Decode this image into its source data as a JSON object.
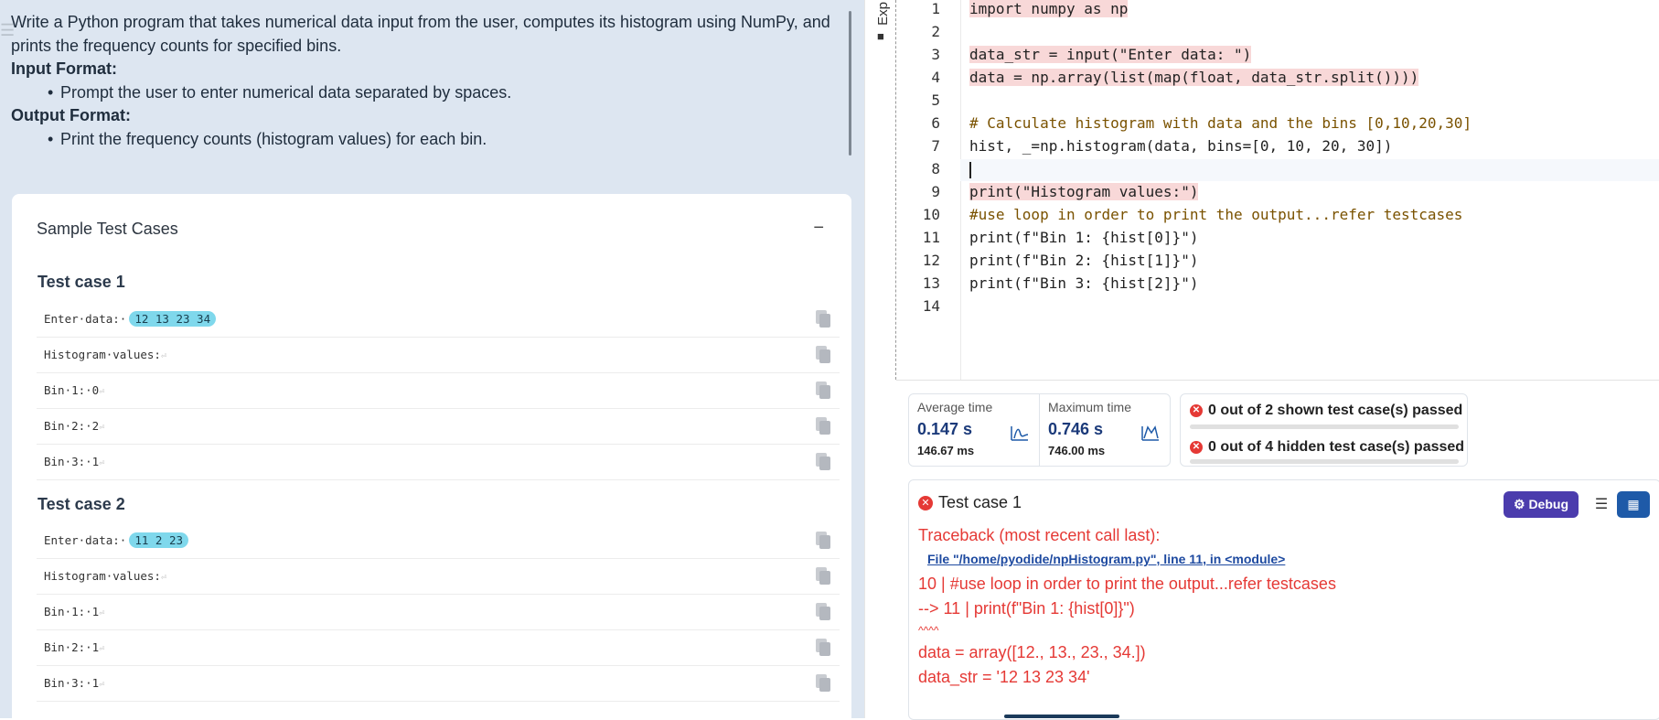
{
  "problem": {
    "line1": "Write a Python program that takes numerical data input from the user, computes its histogram using NumPy, and",
    "line2": "prints the frequency counts for specified bins.",
    "input_heading": "Input Format:",
    "input_bullet": "Prompt the user to enter numerical data separated by spaces.",
    "output_heading": "Output Format:",
    "output_bullet": "Print the frequency counts (histogram values) for each bin."
  },
  "samples": {
    "title": "Sample Test Cases",
    "collapse": "−",
    "cases": [
      {
        "title": "Test case 1",
        "rows": [
          {
            "prefix": "Enter·data:·",
            "input": "12 13 23 34"
          },
          {
            "prefix": "Histogram·values:",
            "input": ""
          },
          {
            "prefix": "Bin·1:·0",
            "input": ""
          },
          {
            "prefix": "Bin·2:·2",
            "input": ""
          },
          {
            "prefix": "Bin·3:·1",
            "input": ""
          }
        ]
      },
      {
        "title": "Test case 2",
        "rows": [
          {
            "prefix": "Enter·data:·",
            "input": "11 2 23"
          },
          {
            "prefix": "Histogram·values:",
            "input": ""
          },
          {
            "prefix": "Bin·1:·1",
            "input": ""
          },
          {
            "prefix": "Bin·2:·1",
            "input": ""
          },
          {
            "prefix": "Bin·3:·1",
            "input": ""
          }
        ]
      }
    ]
  },
  "explorer_label": "Exp",
  "editor": {
    "line_numbers": [
      "1",
      "2",
      "3",
      "4",
      "5",
      "6",
      "7",
      "8",
      "9",
      "10",
      "11",
      "12",
      "13",
      "14"
    ],
    "lines": [
      "import numpy as np",
      "",
      "data_str = input(\"Enter data: \")",
      "data = np.array(list(map(float, data_str.split())))",
      "",
      "# Calculate histogram with data and the bins [0,10,20,30]",
      "hist, _=np.histogram(data, bins=[0, 10, 20, 30])",
      "",
      "print(\"Histogram values:\")",
      "#use loop in order to print the output...refer testcases",
      "print(f\"Bin 1: {hist[0]}\")",
      "print(f\"Bin 2: {hist[1]}\")",
      "print(f\"Bin 3: {hist[2]}\")",
      ""
    ]
  },
  "stats": {
    "avg_label": "Average time",
    "avg_value": "0.147 s",
    "avg_ms": "146.67 ms",
    "max_label": "Maximum time",
    "max_value": "0.746 s",
    "max_ms": "746.00 ms"
  },
  "results": {
    "shown": "0 out of 2 shown test case(s) passed",
    "hidden": "0 out of 4 hidden test case(s) passed",
    "shown_passed_fraction": 0,
    "hidden_passed_fraction": 0
  },
  "output": {
    "title": "Test case 1",
    "debug_label": "Debug",
    "traceback": [
      "Traceback (most recent call last):",
      "File \"/home/pyodide/npHistogram.py\", line 11, in <module>",
      "10 | #use loop in order to print the output...refer testcases",
      "--> 11 | print(f\"Bin 1: {hist[0]}\")",
      "^^^^",
      "data = array([12., 13., 23., 34.])",
      "data_str = '12 13 23 34'"
    ]
  },
  "colors": {
    "accent": "#4b3cad",
    "error": "#e53935",
    "link": "#1e4aa0",
    "left_bg": "#dde6f1",
    "pill": "#7fd8ec"
  }
}
